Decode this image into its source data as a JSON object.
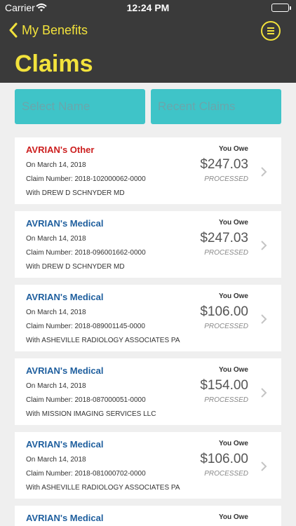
{
  "status_bar": {
    "carrier": "Carrier",
    "time": "12:24 PM"
  },
  "nav": {
    "back_label": "My Benefits",
    "title": "Claims"
  },
  "filters": {
    "select_name": "Select Name",
    "recent_claims": "Recent Claims"
  },
  "colors": {
    "accent_yellow": "#f2e23c",
    "nav_bg": "#3a3a3a",
    "filter_teal": "#3fc4c8",
    "type_red": "#cc1f1f",
    "type_blue": "#1f5f9e"
  },
  "claims": [
    {
      "type": "AVRIAN's Other",
      "type_color": "#cc1f1f",
      "date": "On March 14, 2018",
      "claim_number": "Claim Number: 2018-102000062-0000",
      "provider": "With DREW D SCHNYDER MD",
      "owe_label": "You Owe",
      "amount": "$247.03",
      "status": "PROCESSED"
    },
    {
      "type": "AVRIAN's Medical",
      "type_color": "#1f5f9e",
      "date": "On March 14, 2018",
      "claim_number": "Claim Number: 2018-096001662-0000",
      "provider": "With DREW D SCHNYDER MD",
      "owe_label": "You Owe",
      "amount": "$247.03",
      "status": "PROCESSED"
    },
    {
      "type": "AVRIAN's Medical",
      "type_color": "#1f5f9e",
      "date": "On March 14, 2018",
      "claim_number": "Claim Number: 2018-089001145-0000",
      "provider": "With ASHEVILLE RADIOLOGY ASSOCIATES PA",
      "owe_label": "You Owe",
      "amount": "$106.00",
      "status": "PROCESSED"
    },
    {
      "type": "AVRIAN's Medical",
      "type_color": "#1f5f9e",
      "date": "On March 14, 2018",
      "claim_number": "Claim Number: 2018-087000051-0000",
      "provider": "With MISSION IMAGING SERVICES LLC",
      "owe_label": "You Owe",
      "amount": "$154.00",
      "status": "PROCESSED"
    },
    {
      "type": "AVRIAN's Medical",
      "type_color": "#1f5f9e",
      "date": "On March 14, 2018",
      "claim_number": "Claim Number: 2018-081000702-0000",
      "provider": "With ASHEVILLE RADIOLOGY ASSOCIATES PA",
      "owe_label": "You Owe",
      "amount": "$106.00",
      "status": "PROCESSED"
    },
    {
      "type": "AVRIAN's Medical",
      "type_color": "#1f5f9e",
      "owe_label": "You Owe"
    }
  ]
}
